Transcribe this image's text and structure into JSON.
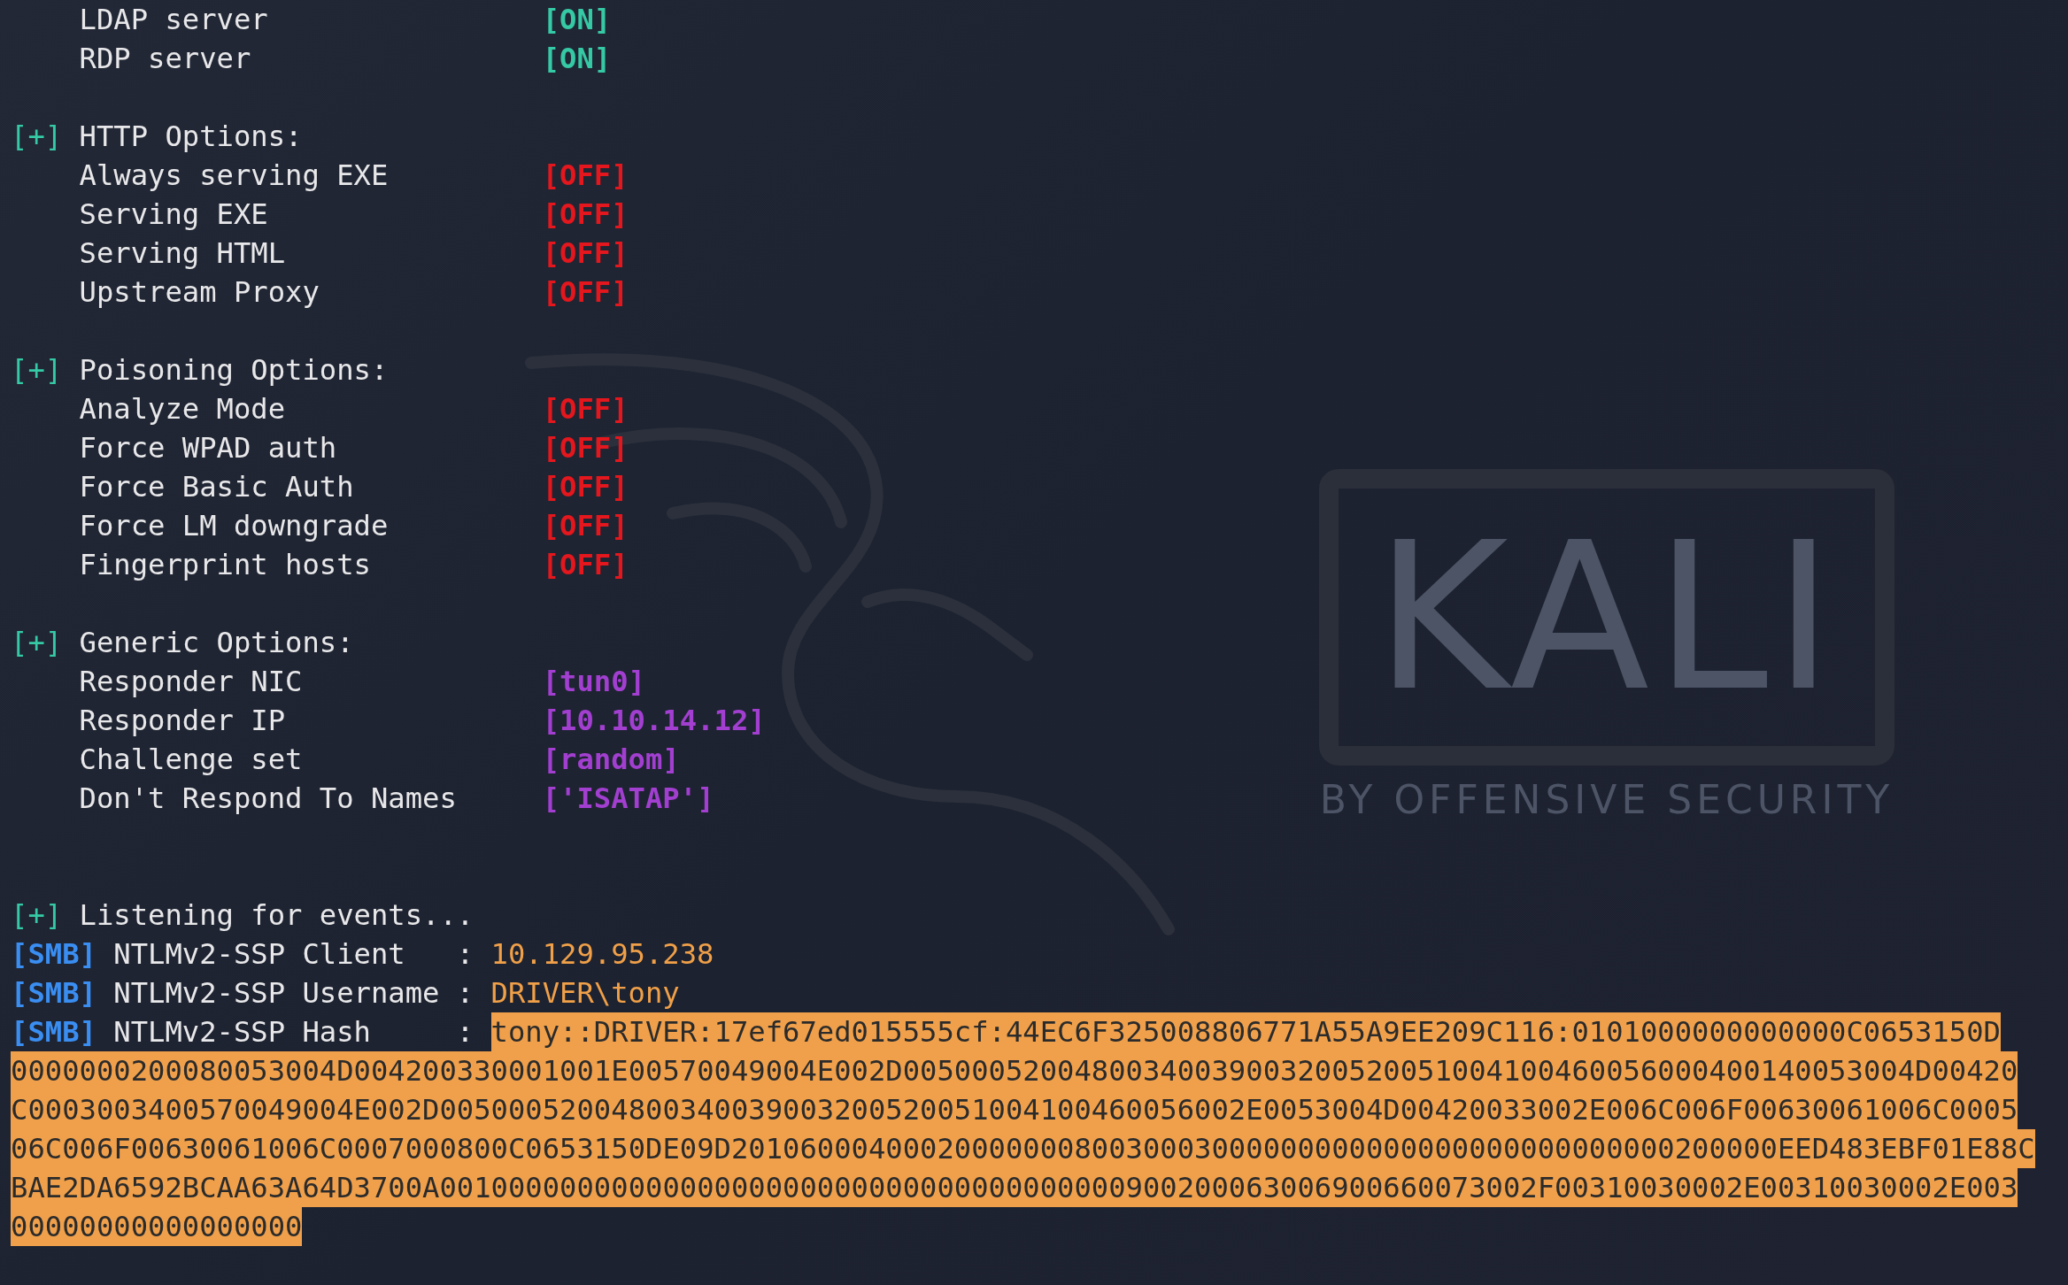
{
  "wallpaper": {
    "logo_text": "KALI",
    "tagline": "BY OFFENSIVE SECURITY"
  },
  "lines": [
    {
      "kind": "setting",
      "label": "LDAP server",
      "value": "[ON]",
      "color": "#35c9a5"
    },
    {
      "kind": "setting",
      "label": "RDP server",
      "value": "[ON]",
      "color": "#35c9a5"
    },
    {
      "kind": "blank"
    },
    {
      "kind": "section",
      "marker": "[+]",
      "text": "HTTP Options:"
    },
    {
      "kind": "setting",
      "label": "Always serving EXE",
      "value": "[OFF]",
      "color": "#e3171d"
    },
    {
      "kind": "setting",
      "label": "Serving EXE",
      "value": "[OFF]",
      "color": "#e3171d"
    },
    {
      "kind": "setting",
      "label": "Serving HTML",
      "value": "[OFF]",
      "color": "#e3171d"
    },
    {
      "kind": "setting",
      "label": "Upstream Proxy",
      "value": "[OFF]",
      "color": "#e3171d"
    },
    {
      "kind": "blank"
    },
    {
      "kind": "section",
      "marker": "[+]",
      "text": "Poisoning Options:"
    },
    {
      "kind": "setting",
      "label": "Analyze Mode",
      "value": "[OFF]",
      "color": "#e3171d"
    },
    {
      "kind": "setting",
      "label": "Force WPAD auth",
      "value": "[OFF]",
      "color": "#e3171d"
    },
    {
      "kind": "setting",
      "label": "Force Basic Auth",
      "value": "[OFF]",
      "color": "#e3171d"
    },
    {
      "kind": "setting",
      "label": "Force LM downgrade",
      "value": "[OFF]",
      "color": "#e3171d"
    },
    {
      "kind": "setting",
      "label": "Fingerprint hosts",
      "value": "[OFF]",
      "color": "#e3171d"
    },
    {
      "kind": "blank"
    },
    {
      "kind": "section",
      "marker": "[+]",
      "text": "Generic Options:"
    },
    {
      "kind": "setting",
      "label": "Responder NIC",
      "value": "[tun0]",
      "color": "#a23fd1"
    },
    {
      "kind": "setting",
      "label": "Responder IP",
      "value": "[10.10.14.12]",
      "color": "#a23fd1"
    },
    {
      "kind": "setting",
      "label": "Challenge set",
      "value": "[random]",
      "color": "#a23fd1"
    },
    {
      "kind": "setting",
      "label": "Don't Respond To Names",
      "value": "['ISATAP']",
      "color": "#a23fd1"
    },
    {
      "kind": "blank"
    },
    {
      "kind": "blank"
    },
    {
      "kind": "section",
      "marker": "[+]",
      "text": "Listening for events..."
    },
    {
      "kind": "event",
      "tag": "[SMB]",
      "label": "NTLMv2-SSP Client",
      "separator": ":",
      "value": "10.129.95.238",
      "highlighted": false
    },
    {
      "kind": "event",
      "tag": "[SMB]",
      "label": "NTLMv2-SSP Username",
      "separator": ":",
      "value": "DRIVER\\tony",
      "highlighted": false
    },
    {
      "kind": "event",
      "tag": "[SMB]",
      "label": "NTLMv2-SSP Hash",
      "separator": ":",
      "value": "tony::DRIVER:17ef67ed015555cf:44EC6F325008806771A55A9EE209C116:0101000000000000C0653150D",
      "highlighted": true
    },
    {
      "kind": "continuation",
      "text": "0000000200080053004D004200330001001E00570049004E002D00500052004800340039003200520051004100460056000400140053004D00420",
      "highlighted": true
    },
    {
      "kind": "continuation",
      "text": "C0003003400570049004E002D00500052004800340039003200520051004100460056002E0053004D00420033002E006C006F00630061006C0005",
      "highlighted": true
    },
    {
      "kind": "continuation",
      "text": "06C006F00630061006C0007000800C0653150DE09D2010600040002000000080030003000000000000000000000000000200000EED483EBF01E88C",
      "highlighted": true
    },
    {
      "kind": "continuation",
      "text": "BAE2DA6592BCAA63A64D3700A0010000000000000000000000000000000000000900200063006900660073002F00310030002E00310030002E003",
      "highlighted": true
    },
    {
      "kind": "continuation",
      "text": "00000000000000000",
      "highlighted": true
    }
  ]
}
